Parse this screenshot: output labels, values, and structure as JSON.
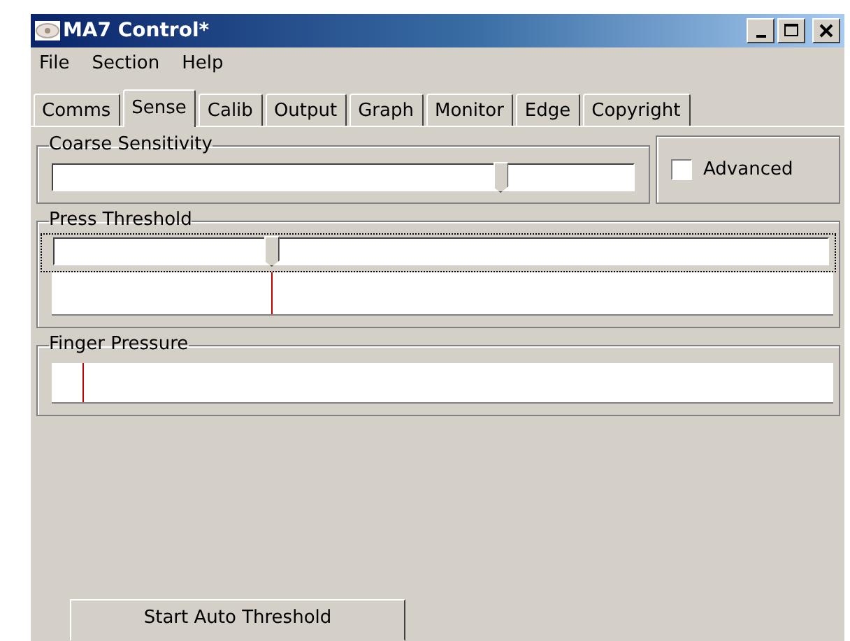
{
  "window": {
    "title": "MA7 Control*"
  },
  "menu": [
    "File",
    "Section",
    "Help"
  ],
  "tabs": [
    {
      "label": "Comms",
      "selected": false
    },
    {
      "label": "Sense",
      "selected": true
    },
    {
      "label": "Calib",
      "selected": false
    },
    {
      "label": "Output",
      "selected": false
    },
    {
      "label": "Graph",
      "selected": false
    },
    {
      "label": "Monitor",
      "selected": false
    },
    {
      "label": "Edge",
      "selected": false
    },
    {
      "label": "Copyright",
      "selected": false
    }
  ],
  "coarse_sensitivity": {
    "label": "Coarse Sensitivity",
    "level": 0.77
  },
  "advanced": {
    "label": "Advanced",
    "checked": false
  },
  "press_threshold": {
    "label": "Press Threshold",
    "level": 0.28,
    "focused": true,
    "meter": {
      "level": 0.28
    }
  },
  "finger_pressure": {
    "label": "Finger Pressure",
    "level": 0.04
  },
  "buttons": [
    "Start Auto Threshold"
  ]
}
